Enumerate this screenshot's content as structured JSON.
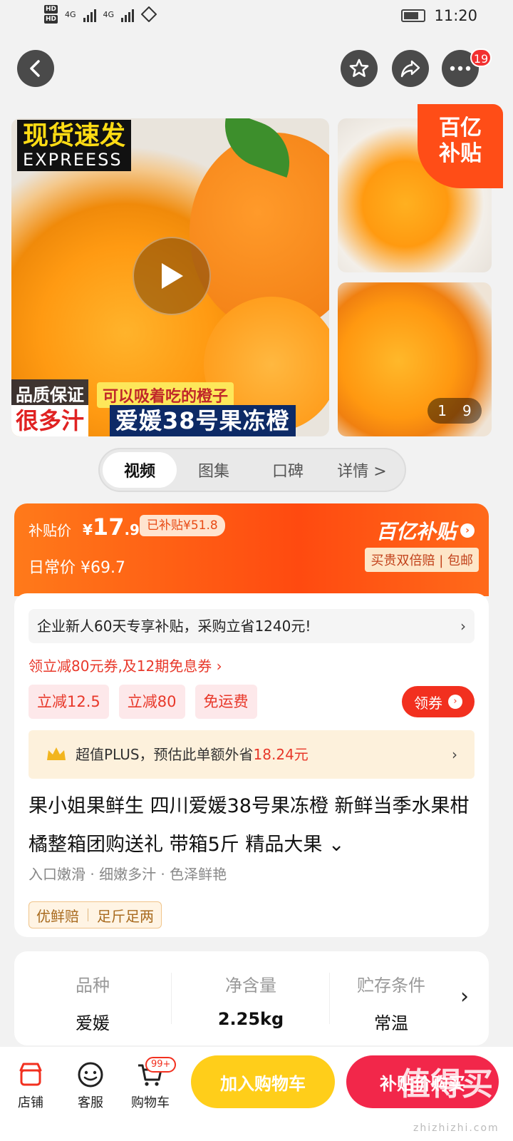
{
  "status_bar": {
    "time": "11:20",
    "hd1": "HD",
    "hd2": "HD",
    "net1": "4G",
    "net2": "4G"
  },
  "nav": {
    "more_badge": "19"
  },
  "gallery": {
    "express_cn": "现货速发",
    "express_en": "EXPREESS",
    "quality": "品质保证",
    "slogan": "可以吸着吃的橙子",
    "juicy": "很多汁",
    "product_banner": "爱媛38号果冻橙",
    "corner_badge_line1": "百亿",
    "corner_badge_line2": "补贴",
    "pager_current": "1",
    "pager_total": "9"
  },
  "tabs": [
    {
      "label": "视频",
      "active": true
    },
    {
      "label": "图集"
    },
    {
      "label": "口碑"
    },
    {
      "label": "详情 >"
    }
  ],
  "price": {
    "subsidy_label": "补贴价",
    "currency": "¥",
    "amount_int": "17",
    "amount_dec": ".9",
    "subsidy_tag": "已补贴¥51.8",
    "regular_label": "日常价 ¥69.7",
    "brand": "百亿补贴",
    "brand_sub": "买贵双倍赔 | 包邮"
  },
  "promos": {
    "enterprise": "企业新人60天专享补贴，采购立省1240元!",
    "coupon_line": "领立减80元券,及12期免息券 ›",
    "chips": [
      "立减12.5",
      "立减80",
      "免运费"
    ],
    "get_coupon": "领券",
    "plus_prefix": "超值PLUS，预估此单额外省",
    "plus_amount": "18.24元"
  },
  "product": {
    "title": "果小姐果鲜生 四川爱媛38号果冻橙 新鲜当季水果柑橘整箱团购送礼 带箱5斤  精品大果 ⌄",
    "features": "入口嫩滑  · 细嫩多汁  · 色泽鲜艳",
    "guarantee_1": "优鲜赔",
    "guarantee_2": "足斤足两"
  },
  "specs": [
    {
      "key": "品种",
      "value": "爱媛"
    },
    {
      "key": "净含量",
      "value": "2.25kg"
    },
    {
      "key": "贮存条件",
      "value": "常温"
    }
  ],
  "bottom_bar": {
    "store": "店铺",
    "service": "客服",
    "cart": "购物车",
    "cart_badge": "99+",
    "add_cart": "加入购物车",
    "buy_now": "补贴价购买"
  },
  "watermark": {
    "text": "值得买",
    "url": "zhizhizhi.com"
  },
  "colors": {
    "accent": "#ff4a10",
    "yellow_button": "#ffce1a",
    "red_button": "#f2274a"
  }
}
